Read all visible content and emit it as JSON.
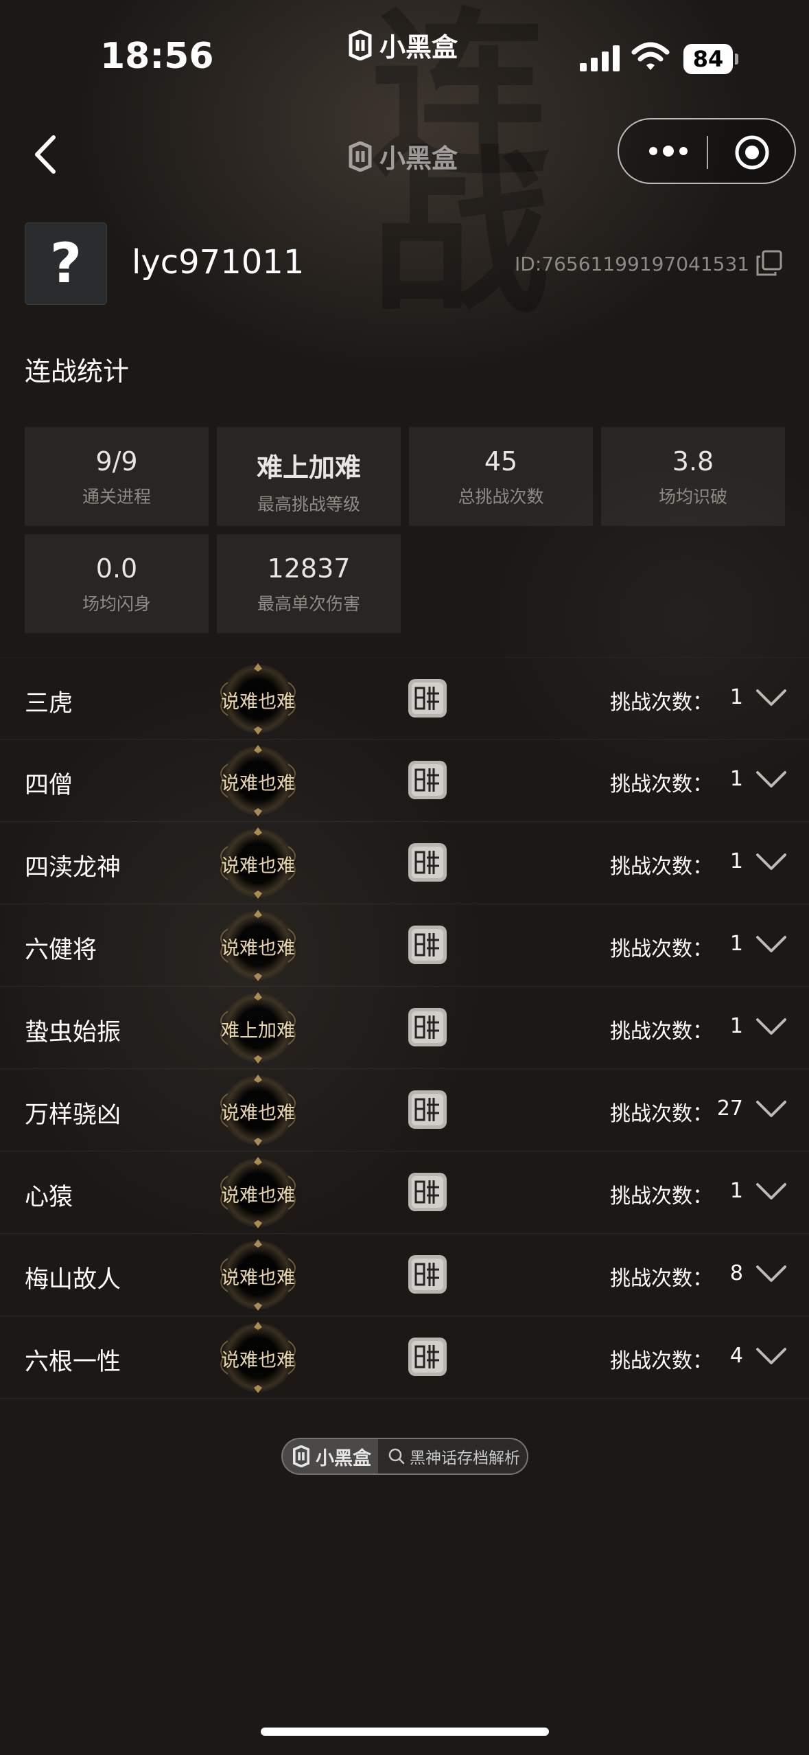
{
  "status_bar": {
    "time": "18:56",
    "brand": "小黑盒",
    "battery": "84"
  },
  "nav": {
    "title": "小黑盒"
  },
  "profile": {
    "avatar_glyph": "?",
    "username": "lyc971011",
    "id_text": "ID:76561199197041531"
  },
  "stats": {
    "title": "连战统计",
    "cards": [
      {
        "value": "9/9",
        "label": "通关进程"
      },
      {
        "value": "难上加难",
        "label": "最高挑战等级"
      },
      {
        "value": "45",
        "label": "总挑战次数"
      },
      {
        "value": "3.8",
        "label": "场均识破"
      },
      {
        "value": "0.0",
        "label": "场均闪身"
      },
      {
        "value": "12837",
        "label": "最高单次伤害"
      }
    ]
  },
  "bosses": {
    "count_label": "挑战次数：",
    "items": [
      {
        "name": "三虎",
        "difficulty": "说难也难",
        "count": "1"
      },
      {
        "name": "四僧",
        "difficulty": "说难也难",
        "count": "1"
      },
      {
        "name": "四渎龙神",
        "difficulty": "说难也难",
        "count": "1"
      },
      {
        "name": "六健将",
        "difficulty": "说难也难",
        "count": "1"
      },
      {
        "name": "蛰虫始振",
        "difficulty": "难上加难",
        "count": "1"
      },
      {
        "name": "万样骁凶",
        "difficulty": "说难也难",
        "count": "27"
      },
      {
        "name": "心猿",
        "difficulty": "说难也难",
        "count": "1"
      },
      {
        "name": "梅山故人",
        "difficulty": "说难也难",
        "count": "8"
      },
      {
        "name": "六根一性",
        "difficulty": "说难也难",
        "count": "4"
      }
    ]
  },
  "footer": {
    "brand": "小黑盒",
    "search_text": "黑神话存档解析"
  },
  "colors": {
    "background": "#1b1816",
    "badge_text": "#e9d6ab",
    "muted_text": "#8e8b87"
  },
  "icons": [
    "brand-mark-icon",
    "signal-icon",
    "wifi-icon",
    "battery-icon",
    "back-arrow-icon",
    "more-dots-icon",
    "target-icon",
    "copy-icon",
    "seal-icon",
    "chevron-down-icon",
    "search-icon"
  ]
}
